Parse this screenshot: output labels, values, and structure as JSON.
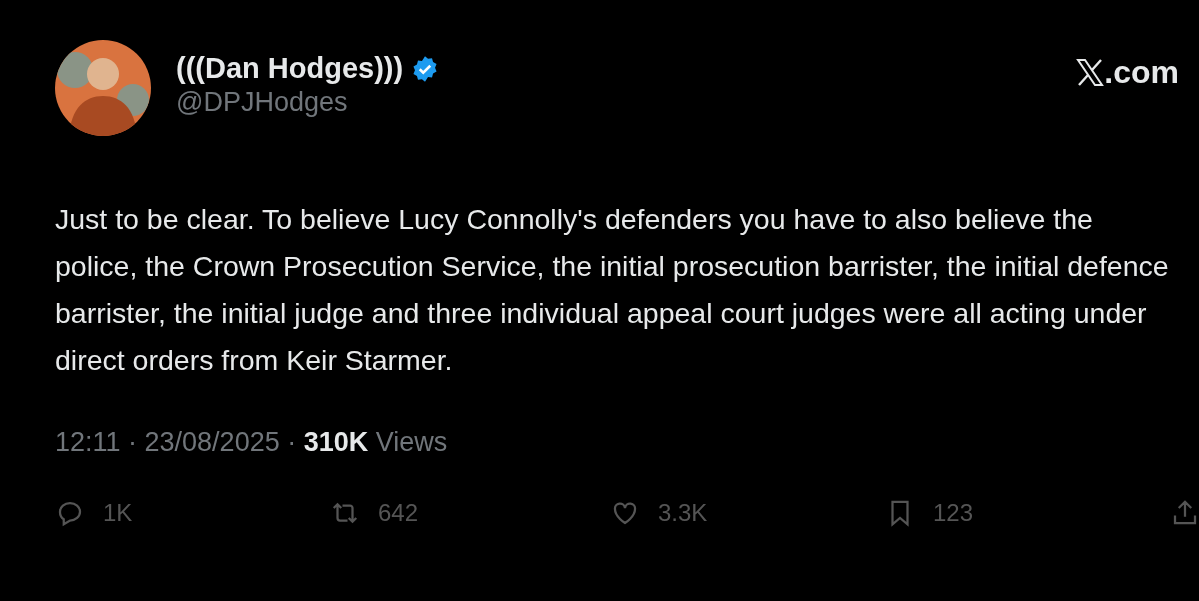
{
  "author": {
    "name": "(((Dan Hodges)))",
    "handle": "@DPJHodges",
    "verified": true
  },
  "site": {
    "suffix": ".com"
  },
  "text": "Just to be clear. To believe Lucy Connolly's defenders you have to also believe the police, the Crown Prosecution Service, the initial prosecution barrister, the initial defence barrister, the initial judge and three individual appeal court judges were all acting under direct orders from Keir Starmer.",
  "meta": "12:11 · 23/08/2025 · **310K** Views",
  "actions": [
    {
      "kind": "reply",
      "count": "1K"
    },
    {
      "kind": "retweet",
      "count": "642"
    },
    {
      "kind": "like",
      "count": "3.3K"
    },
    {
      "kind": "bookmark",
      "count": "123"
    },
    {
      "kind": "share"
    }
  ]
}
